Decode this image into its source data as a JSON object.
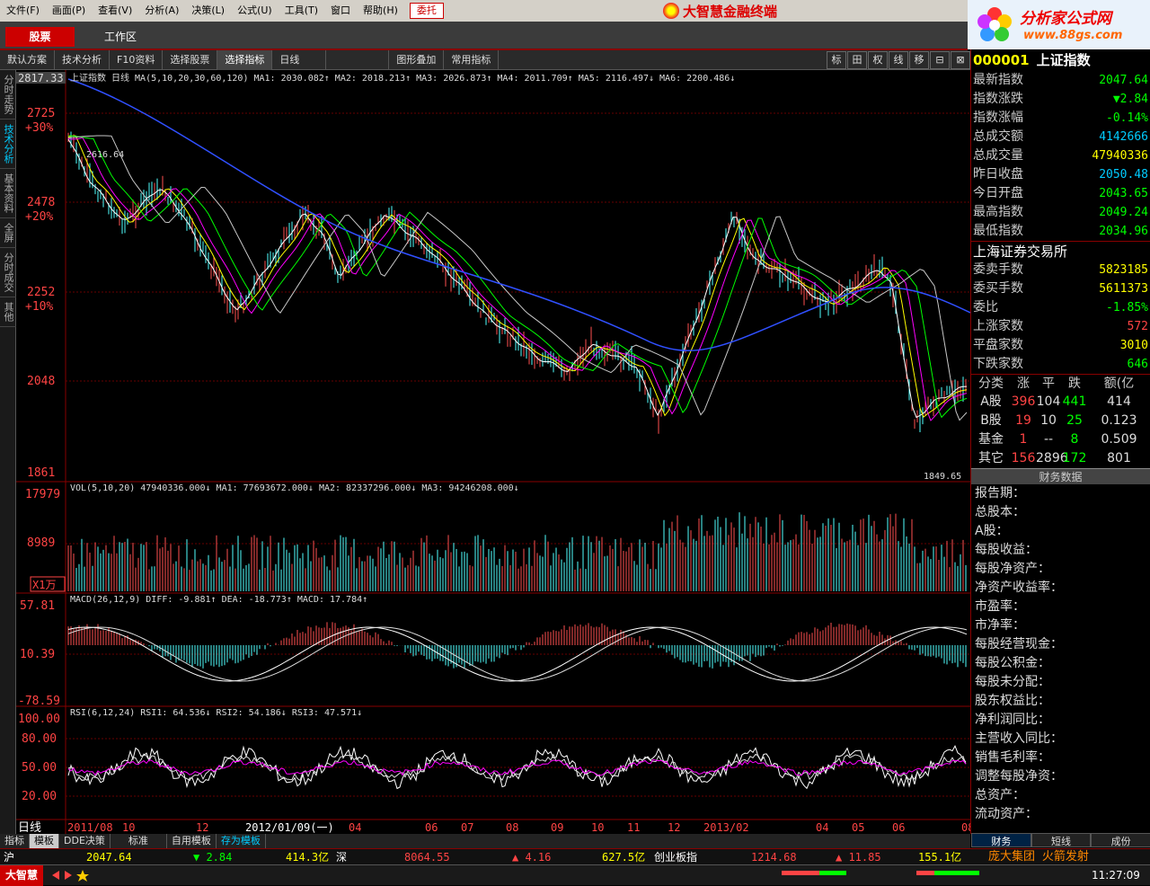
{
  "menu": {
    "items": [
      "文件(F)",
      "画面(P)",
      "查看(V)",
      "分析(A)",
      "决策(L)",
      "公式(U)",
      "工具(T)",
      "窗口",
      "帮助(H)"
    ],
    "entrust": "委托",
    "app_title": "大智慧金融终端"
  },
  "ad": {
    "title": "分析家公式网",
    "url": "www.88gs.com"
  },
  "tabs": {
    "stock": "股票",
    "workspace": "工作区"
  },
  "toolbar": {
    "items": [
      "默认方案",
      "技术分析",
      "F10资料",
      "选择股票",
      "选择指标",
      "日线",
      "",
      "图形叠加",
      "常用指标"
    ],
    "right": [
      "标",
      "田",
      "权",
      "线",
      "移",
      "⊟",
      "⊠"
    ]
  },
  "leftside": [
    "分时走势",
    "技术分析",
    "基本资料",
    "全屏",
    "分时成交",
    "其他"
  ],
  "chart": {
    "price_header": "上证指数 日线 MA(5,10,20,30,60,120)  MA1: 2030.082↑  MA2: 2018.213↑  MA3: 2026.873↑  MA4: 2011.709↑  MA5: 2116.497↓  MA6: 2200.486↓",
    "price_ticks": [
      "2817.33",
      "2725",
      "+30%",
      "2478",
      "+20%",
      "2252",
      "+10%",
      "2048",
      "1861"
    ],
    "high_label": "2616.64",
    "low_label": "1849.65",
    "vol_header": "VOL(5,10,20)  47940336.000↓  MA1: 77693672.000↓  MA2: 82337296.000↓  MA3: 94246208.000↓",
    "vol_ticks": [
      "17979",
      "8989",
      "X1万"
    ],
    "macd_header": "MACD(26,12,9)  DIFF: -9.881↑  DEA: -18.773↑  MACD: 17.784↑",
    "macd_ticks": [
      "57.81",
      "10.39",
      "-78.59"
    ],
    "rsi_header": "RSI(6,12,24)  RSI1: 64.536↓  RSI2: 54.186↓  RSI3: 47.571↓",
    "rsi_ticks": [
      "100.00",
      "80.00",
      "50.00",
      "20.00"
    ],
    "period": "日线",
    "dates": [
      "2011/08",
      "10",
      "12",
      "2012/01/09(一)",
      "04",
      "06",
      "07",
      "08",
      "09",
      "10",
      "11",
      "12",
      "2013/02",
      "04",
      "05",
      "06",
      "08"
    ],
    "colors": {
      "up": "#ff5050",
      "down": "#50ffff",
      "ma1": "#ffffff",
      "ma2": "#ffff00",
      "ma3": "#ff00ff",
      "ma4": "#00ff00",
      "ma5": "#c8c8c8",
      "ma6": "#3050ff"
    }
  },
  "quote": {
    "code": "000001",
    "name": "上证指数",
    "rows": [
      [
        "最新指数",
        "2047.64"
      ],
      [
        "指数涨跌",
        "▼2.84"
      ],
      [
        "指数涨幅",
        "-0.14%"
      ],
      [
        "总成交额",
        "4142666"
      ],
      [
        "总成交量",
        "47940336"
      ],
      [
        "昨日收盘",
        "2050.48"
      ],
      [
        "今日开盘",
        "2043.65"
      ],
      [
        "最高指数",
        "2049.24"
      ],
      [
        "最低指数",
        "2034.96"
      ]
    ],
    "exchange": "上海证券交易所",
    "rows2": [
      [
        "委卖手数",
        "5823185"
      ],
      [
        "委买手数",
        "5611373"
      ],
      [
        "委比",
        "-1.85%"
      ],
      [
        "上涨家数",
        "572"
      ],
      [
        "平盘家数",
        "3010"
      ],
      [
        "下跌家数",
        "646"
      ]
    ],
    "table_head": [
      "分类",
      "涨",
      "平",
      "跌",
      "额(亿"
    ],
    "table": [
      [
        "A股",
        "396",
        "104",
        "441",
        "414"
      ],
      [
        "B股",
        "19",
        "10",
        "25",
        "0.123"
      ],
      [
        "基金",
        "1",
        "--",
        "8",
        "0.509"
      ],
      [
        "其它",
        "156",
        "2896",
        "172",
        "801"
      ]
    ],
    "fin_title": "财务数据",
    "fin": [
      "报告期：",
      "总股本：",
      "A股：",
      "每股收益：",
      "每股净资产：",
      "净资产收益率：",
      "市盈率：",
      "市净率：",
      "每股经营现金：",
      "每股公积金：",
      "每股未分配：",
      "股东权益比：",
      "净利润同比：",
      "主营收入同比：",
      "销售毛利率：",
      "调整每股净资：",
      "总资产：",
      "流动资产："
    ],
    "tabs": [
      "财务",
      "短线",
      "成份"
    ]
  },
  "bottom": {
    "tabs": [
      "指标",
      "模板",
      "DDE决策",
      "标准",
      "自用模板",
      "存为模板"
    ],
    "sh": "沪",
    "sh_index": "2047.64",
    "sh_change": "▼ 2.84",
    "sh_amount": "414.3亿",
    "sz": "深",
    "sz_index": "8064.55",
    "sz_change": "▲ 4.16",
    "sz_amount": "627.5亿",
    "cyb": "创业板指",
    "cyb_index": "1214.68",
    "cyb_change": "▲ 11.85",
    "cyb_amount": "155.1亿",
    "brand": "大智慧",
    "news": "庞大集团 火箭发射",
    "time": "11:27:09"
  }
}
